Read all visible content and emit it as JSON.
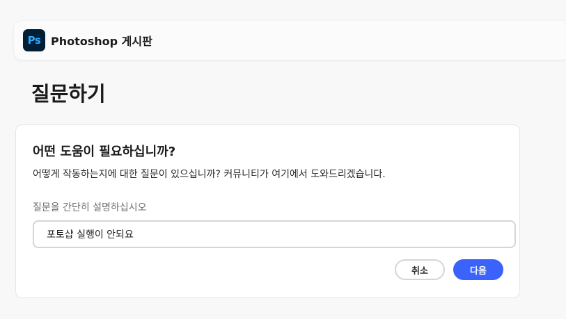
{
  "app": {
    "logo_text": "Ps",
    "title": "Photoshop 게시판"
  },
  "page": {
    "title": "질문하기"
  },
  "card": {
    "heading": "어떤 도움이 필요하십니까?",
    "description": "어떻게 작동하는지에 대한 질문이 있으십니까? 커뮤니티가 여기에서 도와드리겠습니다.",
    "field_label": "질문을 간단히 설명하십시오",
    "field_value": "포토샵 실행이 안되요",
    "cancel_label": "취소",
    "next_label": "다음"
  },
  "colors": {
    "ps_logo_bg": "#001e36",
    "ps_logo_text": "#31a8ff",
    "primary_button": "#3b63fb"
  }
}
